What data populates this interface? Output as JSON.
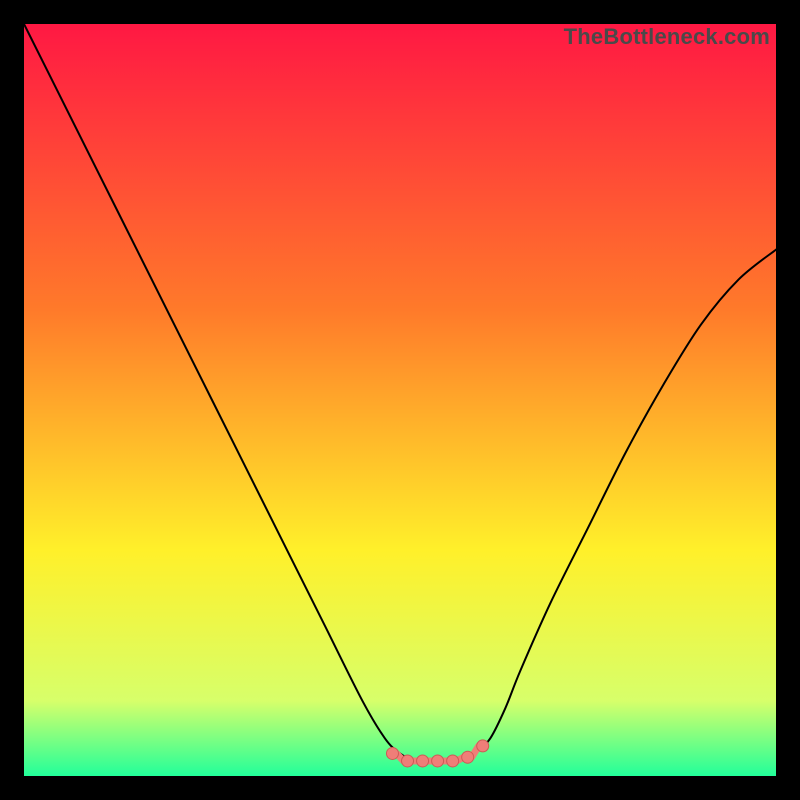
{
  "watermark": "TheBottleneck.com",
  "colors": {
    "gradient_top": "#ff1843",
    "gradient_mid1": "#ff7a2a",
    "gradient_mid2": "#fff02a",
    "gradient_mid3": "#d7ff6a",
    "gradient_bottom": "#22ff9a",
    "curve": "#000000",
    "marker_fill": "#ef7e78",
    "marker_stroke": "#cc5b55"
  },
  "chart_data": {
    "type": "line",
    "title": "",
    "xlabel": "",
    "ylabel": "",
    "xlim": [
      0,
      100
    ],
    "ylim": [
      0,
      100
    ],
    "series": [
      {
        "name": "bottleneck-curve",
        "x": [
          0,
          5,
          10,
          15,
          20,
          25,
          30,
          35,
          40,
          45,
          48,
          50,
          52,
          54,
          56,
          58,
          60,
          62,
          64,
          66,
          70,
          75,
          80,
          85,
          90,
          95,
          100
        ],
        "y": [
          100,
          90,
          80,
          70,
          60,
          50,
          40,
          30,
          20,
          10,
          5,
          3,
          2,
          2,
          2,
          2,
          3,
          5,
          9,
          14,
          23,
          33,
          43,
          52,
          60,
          66,
          70
        ]
      }
    ],
    "markers": {
      "name": "flat-region",
      "x": [
        49,
        51,
        53,
        55,
        57,
        59,
        61
      ],
      "y": [
        3,
        2,
        2,
        2,
        2,
        2.5,
        4
      ]
    },
    "grid": false,
    "legend": false
  }
}
